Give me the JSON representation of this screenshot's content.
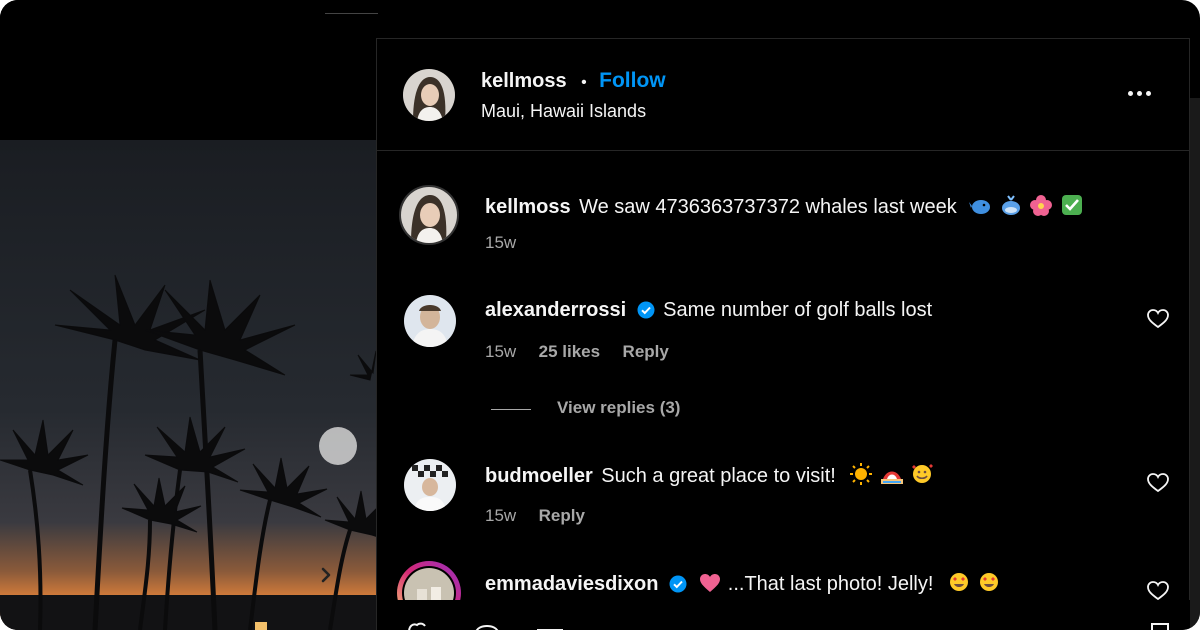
{
  "post": {
    "author": "kellmoss",
    "separator": "•",
    "follow_label": "Follow",
    "location": "Maui, Hawaii Islands"
  },
  "caption": {
    "username": "kellmoss",
    "text": "We saw 4736363737372 whales last week",
    "emojis": [
      "whale-emoji",
      "spouting-whale-emoji",
      "hibiscus-emoji",
      "check-mark-emoji"
    ],
    "time": "15w"
  },
  "comments": [
    {
      "username": "alexanderrossi",
      "verified": true,
      "text": "Same number of golf balls lost",
      "time": "15w",
      "likes": "25 likes",
      "reply_label": "Reply",
      "view_replies": "View replies (3)"
    },
    {
      "username": "budmoeller",
      "verified": false,
      "text": "Such a great place to visit!",
      "emojis": [
        "sun-emoji",
        "beach-emoji",
        "smiling-hearts-emoji"
      ],
      "time": "15w",
      "reply_label": "Reply"
    },
    {
      "username": "emmadaviesdixon",
      "verified": true,
      "text": "...That last photo! Jelly!",
      "emojis": [
        "pink-heart-emoji",
        "heart-eyes-emoji",
        "heart-eyes-emoji"
      ]
    }
  ],
  "colors": {
    "background": "#000000",
    "text": "#f5f5f5",
    "muted": "#a8a8a8",
    "accent": "#0095f6",
    "verified": "#0095f6"
  }
}
